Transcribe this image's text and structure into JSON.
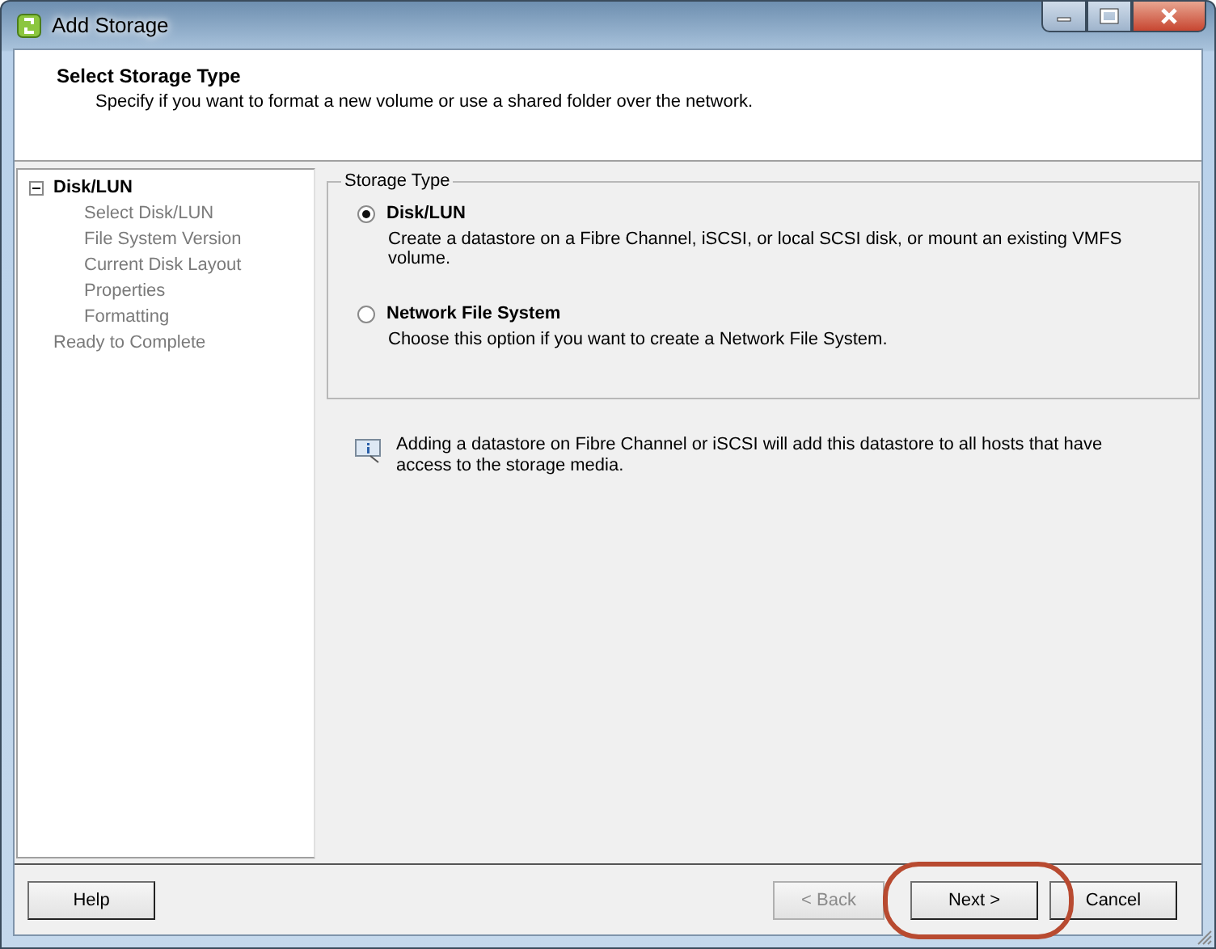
{
  "window": {
    "title": "Add Storage"
  },
  "header": {
    "title": "Select Storage Type",
    "subtitle": "Specify if you want to format a new volume or use a shared folder over the network."
  },
  "steps": [
    {
      "label": "Disk/LUN",
      "current": true,
      "expanded": true,
      "children": [
        {
          "label": "Select Disk/LUN",
          "current": false
        },
        {
          "label": "File System Version",
          "current": false
        },
        {
          "label": "Current Disk Layout",
          "current": false
        },
        {
          "label": "Properties",
          "current": false
        },
        {
          "label": "Formatting",
          "current": false
        }
      ]
    },
    {
      "label": "Ready to Complete",
      "current": false
    }
  ],
  "storage_type": {
    "legend": "Storage Type",
    "options": [
      {
        "label": "Disk/LUN",
        "description": "Create a datastore on a Fibre Channel, iSCSI, or local SCSI disk, or mount an existing VMFS volume.",
        "selected": true
      },
      {
        "label": "Network File System",
        "description": "Choose this option if you want to create a Network File System.",
        "selected": false
      }
    ]
  },
  "info": "Adding a datastore on Fibre Channel or iSCSI will add this datastore to all hosts that have access to the storage media.",
  "buttons": [
    {
      "label": "Help",
      "kind": "left",
      "disabled": false,
      "highlighted": false
    },
    {
      "label": "< Back",
      "kind": "right",
      "disabled": true,
      "highlighted": false
    },
    {
      "label": "Next >",
      "kind": "right",
      "disabled": false,
      "highlighted": true
    },
    {
      "label": "Cancel",
      "kind": "right",
      "disabled": false,
      "highlighted": false
    }
  ]
}
